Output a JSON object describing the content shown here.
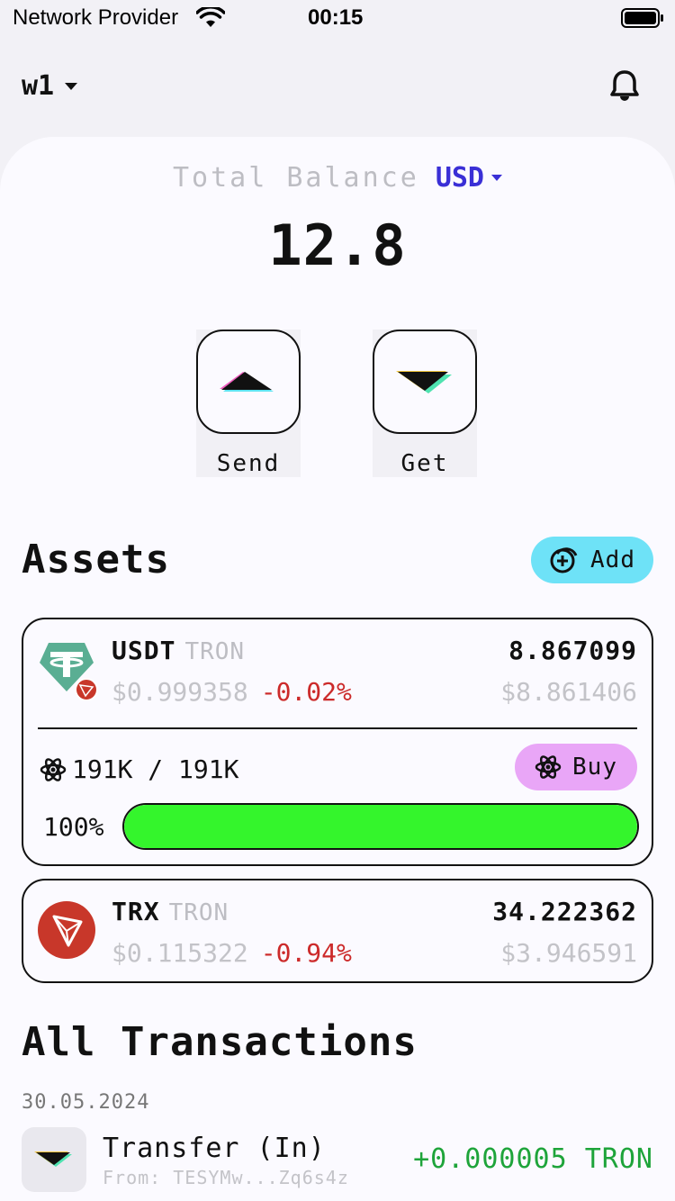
{
  "status_bar": {
    "carrier": "Network Provider",
    "time": "00:15"
  },
  "header": {
    "wallet_name": "w1",
    "wallet_icon": "chevron-down-icon",
    "bell_icon": "bell-icon"
  },
  "balance": {
    "label": "Total Balance",
    "currency": "USD",
    "value": "12.8"
  },
  "actions": {
    "send_label": "Send",
    "get_label": "Get"
  },
  "assets": {
    "title": "Assets",
    "add_label": "Add",
    "items": [
      {
        "symbol": "USDT",
        "network": "TRON",
        "price": "$0.999358",
        "change": "-0.02%",
        "amount": "8.867099",
        "value": "$8.861406",
        "energy": "191K / 191K",
        "buy_label": "Buy",
        "energy_percent_label": "100%",
        "energy_fraction": 1.0
      },
      {
        "symbol": "TRX",
        "network": "TRON",
        "price": "$0.115322",
        "change": "-0.94%",
        "amount": "34.222362",
        "value": "$3.946591"
      }
    ]
  },
  "transactions": {
    "title": "All Transactions",
    "date": "30.05.2024",
    "items": [
      {
        "title": "Transfer (In)",
        "from": "From: TESYMw...Zq6s4z",
        "amount": "+0.000005 TRON"
      }
    ]
  },
  "colors": {
    "accent": "#3a2fd6",
    "add_button": "#6ee2f7",
    "buy_button": "#e9a6f7",
    "progress": "#34f52c",
    "negative": "#cc2a2a",
    "positive": "#1ea43a"
  }
}
